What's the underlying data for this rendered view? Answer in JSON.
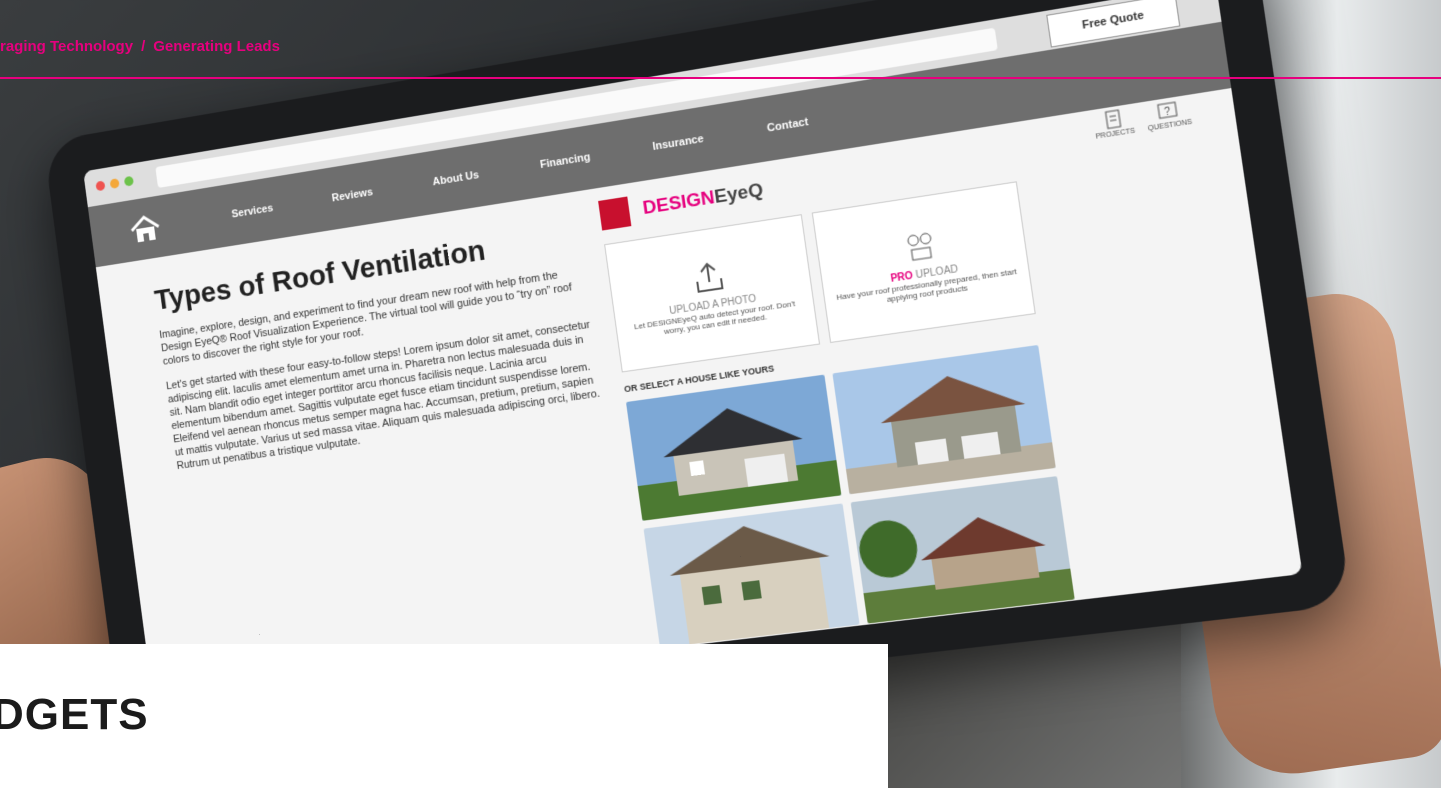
{
  "breadcrumb": {
    "items": [
      "raging Technology",
      "Generating Leads"
    ],
    "separator": "/"
  },
  "browser": {
    "free_quote": "Free Quote"
  },
  "nav": {
    "items": [
      "Services",
      "Reviews",
      "About Us",
      "Financing",
      "Insurance",
      "Contact"
    ]
  },
  "content": {
    "title": "Types of Roof Ventilation",
    "paragraph1": "Imagine, explore, design, and experiment to find your dream new roof with help from the Design EyeQ® Roof Visualization Experience. The virtual tool will guide you to “try on” roof colors to discover the right style for your roof.",
    "paragraph2": "Let's get started with these four easy-to-follow steps! Lorem ipsum dolor sit amet, consectetur adipiscing elit. Iaculis amet elementum amet urna in. Pharetra non lectus malesuada duis in sit. Nam blandit odio eget integer porttitor arcu rhoncus facilisis neque. Lacinia arcu elementum bibendum amet. Sagittis vulputate eget fusce etiam tincidunt suspendisse lorem. Eleifend vel aenean rhoncus metus semper magna hac. Accumsan, pretium, pretium, sapien ut mattis vulputate. Varius ut sed massa vitae. Aliquam quis malesuada adipiscing orci, libero. Rutrum ut penatibus a tristique vulputate."
  },
  "panel": {
    "brand_part1": "DESIGN",
    "brand_part2": "EyeQ",
    "top_icons": [
      "PROJECTS",
      "QUESTIONS"
    ],
    "upload_photo": {
      "label": "UPLOAD A PHOTO",
      "desc": "Let DESIGNEyeQ auto detect your roof. Don't worry, you can edit if needed."
    },
    "pro_upload": {
      "label_pro": "PRO",
      "label_rest": " UPLOAD",
      "desc": "Have your roof professionally prepared, then start applying roof products"
    },
    "select_label": "OR SELECT A HOUSE LIKE YOURS"
  },
  "bottom": {
    "title": "DGETS"
  },
  "colors": {
    "accent": "#e6007e",
    "nav_bg": "#6e6e6e",
    "brand_red": "#c8102e"
  }
}
